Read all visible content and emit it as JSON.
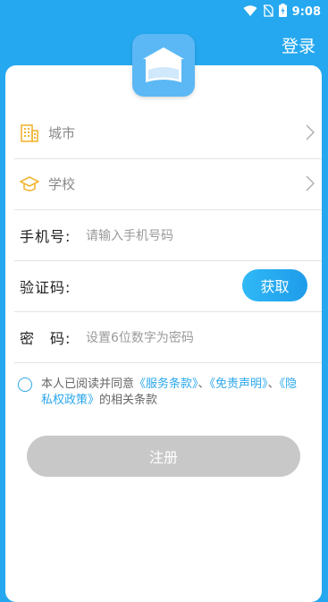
{
  "status": {
    "time": "9:08"
  },
  "header": {
    "login_label": "登录"
  },
  "form": {
    "city": {
      "label": "城市"
    },
    "school": {
      "label": "学校"
    },
    "phone": {
      "label": "手机号:",
      "placeholder": "请输入手机号码"
    },
    "code": {
      "label": "验证码:",
      "button": "获取"
    },
    "password": {
      "label": "密　码:",
      "placeholder": "设置6位数字为密码"
    }
  },
  "agreement": {
    "prefix": "本人已阅读并同意",
    "terms": "《服务条款》",
    "sep1": "、",
    "disclaimer": "《免责声明》",
    "sep2": "、",
    "privacy": "《隐私权政策》",
    "suffix": "的相关条款"
  },
  "register_label": "注册",
  "colors": {
    "primary": "#25A8EF",
    "link": "#2BA7EC",
    "disabled": "#C8C8C8"
  }
}
